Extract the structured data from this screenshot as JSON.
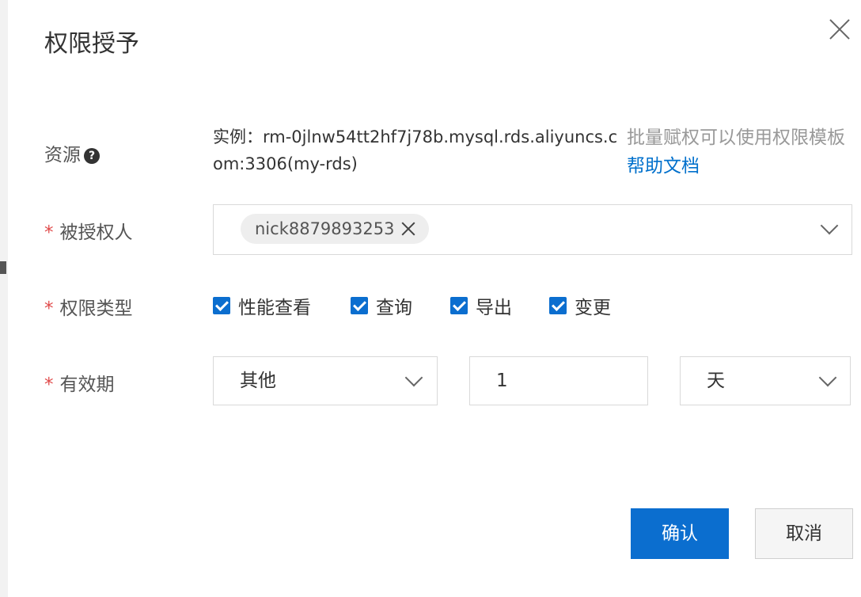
{
  "dialog": {
    "title": "权限授予",
    "resource": {
      "label": "资源",
      "help_icon": "question-circle-icon",
      "value": "实例：rm-0jlnw54tt2hf7j78b.mysql.rds.aliyuncs.com:3306(my-rds)",
      "hint_prefix": "批量赋权可以使用权限模板",
      "hint_link": "帮助文档"
    },
    "grantee": {
      "required_mark": "*",
      "label": "被授权人",
      "tags": [
        "nick8879893253"
      ]
    },
    "permission_type": {
      "required_mark": "*",
      "label": "权限类型",
      "options": [
        {
          "label": "性能查看",
          "checked": true
        },
        {
          "label": "查询",
          "checked": true
        },
        {
          "label": "导出",
          "checked": true
        },
        {
          "label": "变更",
          "checked": true
        }
      ]
    },
    "validity": {
      "required_mark": "*",
      "label": "有效期",
      "period_type": "其他",
      "amount": "1",
      "unit": "天"
    },
    "buttons": {
      "confirm": "确认",
      "cancel": "取消"
    }
  },
  "colors": {
    "primary": "#0b6ecf",
    "required": "#e04b4b",
    "link": "#0070cc"
  }
}
